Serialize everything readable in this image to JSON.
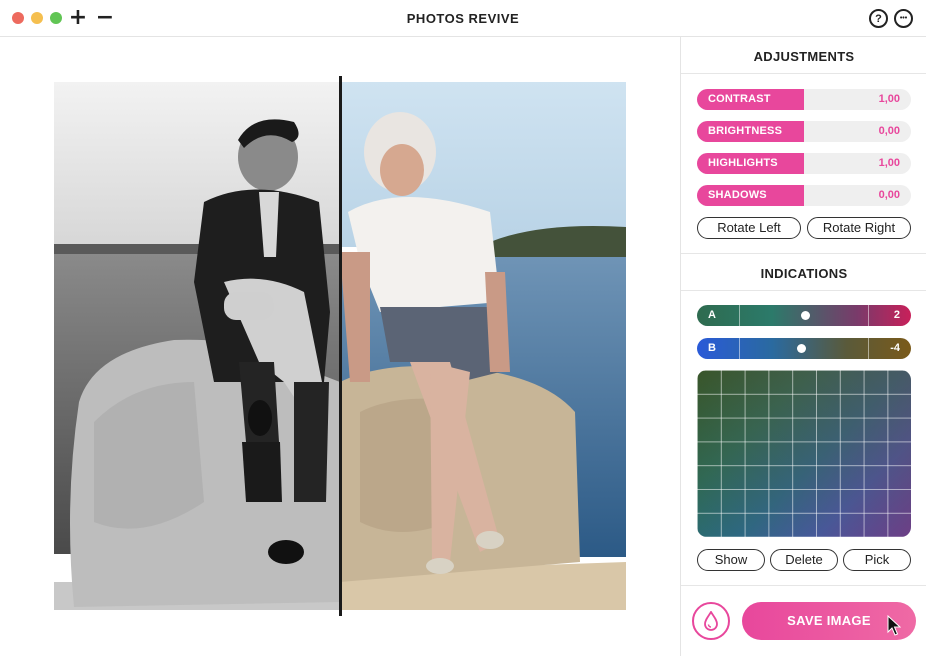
{
  "window": {
    "title": "PHOTOS REVIVE",
    "add_glyph": "+",
    "remove_glyph": "−",
    "help_glyph": "?",
    "more_glyph": "•••"
  },
  "photo": {
    "before_label": "black-and-white original",
    "after_label": "colorized result"
  },
  "adjustments": {
    "title": "ADJUSTMENTS",
    "sliders": [
      {
        "label": "CONTRAST",
        "value": "1,00",
        "level": 0.5
      },
      {
        "label": "BRIGHTNESS",
        "value": "0,00",
        "level": 0.5
      },
      {
        "label": "HIGHLIGHTS",
        "value": "1,00",
        "level": 0.5
      },
      {
        "label": "SHADOWS",
        "value": "0,00",
        "level": 0.5
      }
    ],
    "rotate_left": "Rotate Left",
    "rotate_right": "Rotate Right"
  },
  "indications": {
    "title": "INDICATIONS",
    "a": {
      "label": "A",
      "value": "2",
      "position": 0.5
    },
    "b": {
      "label": "B",
      "value": "-4",
      "position": 0.5
    },
    "show": "Show",
    "delete": "Delete",
    "pick": "Pick"
  },
  "save": {
    "label": "SAVE IMAGE"
  },
  "colors": {
    "accent": "#e8479c",
    "a_gradient": [
      "#2e6b4f",
      "#2c7a6a",
      "#7a3a6a",
      "#c8205a"
    ],
    "b_gradient": [
      "#2a5ad8",
      "#2a6aa0",
      "#5a5a3a",
      "#7a5a1a"
    ]
  }
}
